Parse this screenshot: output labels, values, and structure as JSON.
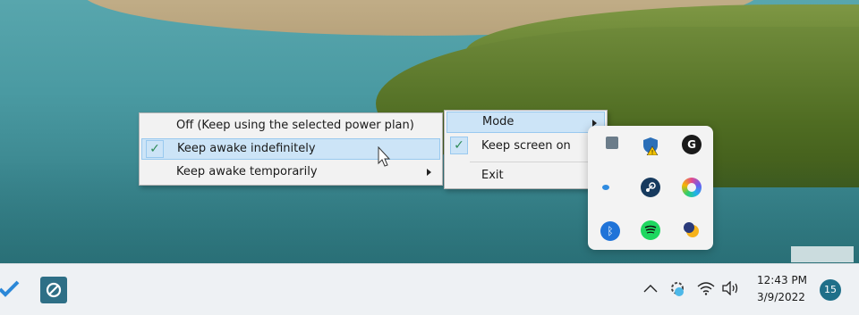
{
  "main_menu": {
    "items": [
      {
        "label": "Off (Keep using the selected power plan)",
        "checked": false,
        "submenu": false
      },
      {
        "label": "Keep awake indefinitely",
        "checked": true,
        "submenu": false
      },
      {
        "label": "Keep awake temporarily",
        "checked": false,
        "submenu": true
      }
    ]
  },
  "sub_menu": {
    "items": [
      {
        "label": "Mode",
        "submenu": true
      },
      {
        "label": "Keep screen on",
        "checked": true
      },
      {
        "label": "Exit"
      }
    ]
  },
  "tray_flyout": {
    "icons": [
      "monitor-icon",
      "defender-warning-icon",
      "github-icon",
      "cloud-icon",
      "steam-icon",
      "copilot-icon",
      "bluetooth-icon",
      "spotify-icon",
      "awake-icon"
    ]
  },
  "taskbar": {
    "time": "12:43 PM",
    "date": "3/9/2022",
    "notification_count": "15"
  },
  "colors": {
    "menu_bg": "#f2f2f2",
    "highlight": "#cce4f7",
    "highlight_border": "#99c9ef",
    "check": "#2e8b57",
    "badge": "#1f6f89"
  }
}
